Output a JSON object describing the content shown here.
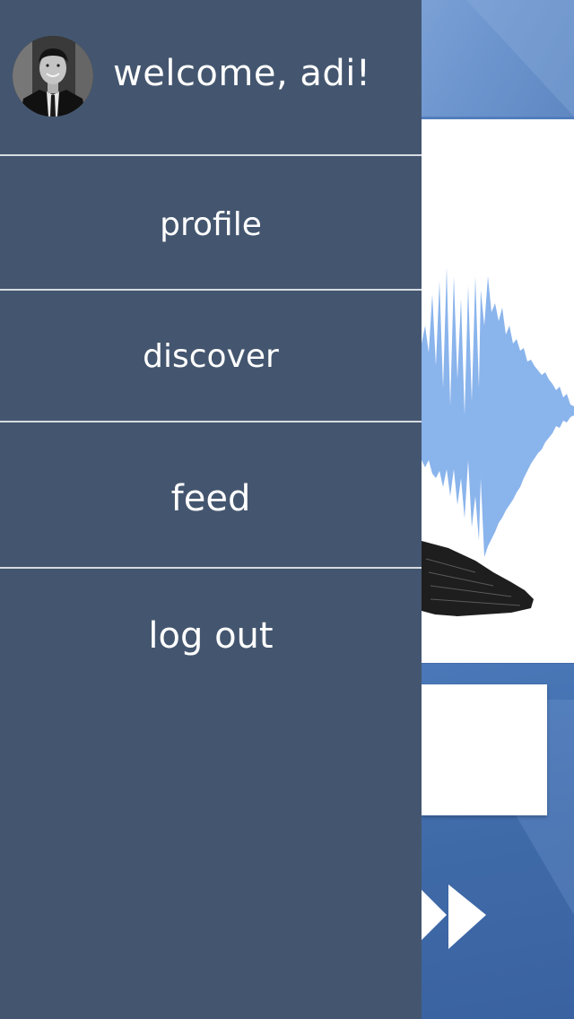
{
  "drawer": {
    "welcome_text": "welcome, adi!",
    "menu": [
      {
        "label": "profile"
      },
      {
        "label": "discover"
      },
      {
        "label": "feed"
      },
      {
        "label": "log out"
      }
    ]
  },
  "colors": {
    "drawer_bg": "#44566f",
    "divider": "#d6dbe2",
    "waveform": "#8ab4ec",
    "app_bg": "#4b78b7"
  },
  "icons": {
    "avatar": "user-avatar-photo",
    "playback": "fast-forward-icon"
  }
}
